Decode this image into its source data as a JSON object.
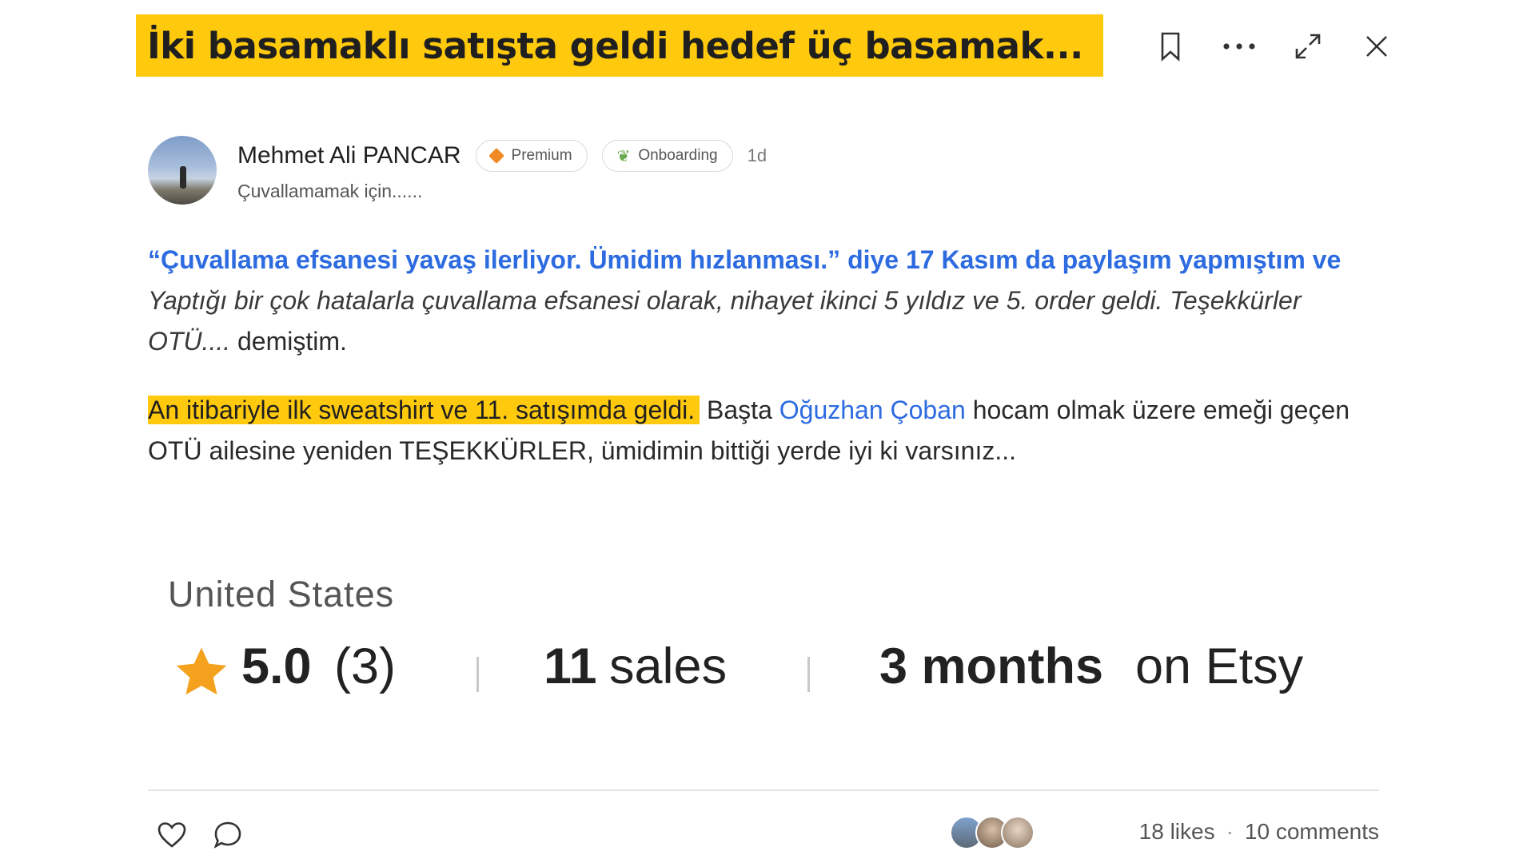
{
  "post": {
    "title": "İki basamaklı satışta geldi hedef üç basamak...",
    "author": {
      "name": "Mehmet Ali PANCAR",
      "subtitle": "Çuvallamamak için......",
      "badges": [
        "Premium",
        "Onboarding"
      ],
      "age": "1d"
    },
    "paragraph1": {
      "quote": "“Çuvallama efsanesi yavaş ilerliyor. Ümidim hızlanması.” diye 17 Kasım da paylaşım yapmıştım ve",
      "italic": "Yaptığı bir çok hatalarla çuvallama efsanesi olarak, nihayet ikinci 5 yıldız ve 5. order geldi. Teşekkürler OTÜ....",
      "tail": "demiştim."
    },
    "paragraph2": {
      "highlight": "An itibariyle ilk sweatshirt ve 11. satışımda geldi.",
      "pre_link": "Başta",
      "link": "Oğuzhan Çoban",
      "rest": "hocam olmak üzere emeği geçen OTÜ ailesine yeniden TEŞEKKÜRLER, ümidimin bittiği yerde iyi ki varsınız..."
    }
  },
  "etsy": {
    "country": "United States",
    "rating": "5.0",
    "review_count": "(3)",
    "sales_number": "11",
    "sales_label": "sales",
    "duration_bold": "3 months",
    "duration_rest": "on Etsy"
  },
  "footer": {
    "likes": "18 likes",
    "separator": "·",
    "comments": "10 comments"
  },
  "icons": [
    "bookmark-icon",
    "more-icon",
    "expand-icon",
    "close-icon",
    "heart-icon",
    "comment-icon",
    "star-icon"
  ],
  "colors": {
    "highlight": "#ffc90e",
    "link": "#2d6be0",
    "star": "#f4a21d",
    "premium": "#f08a24"
  }
}
